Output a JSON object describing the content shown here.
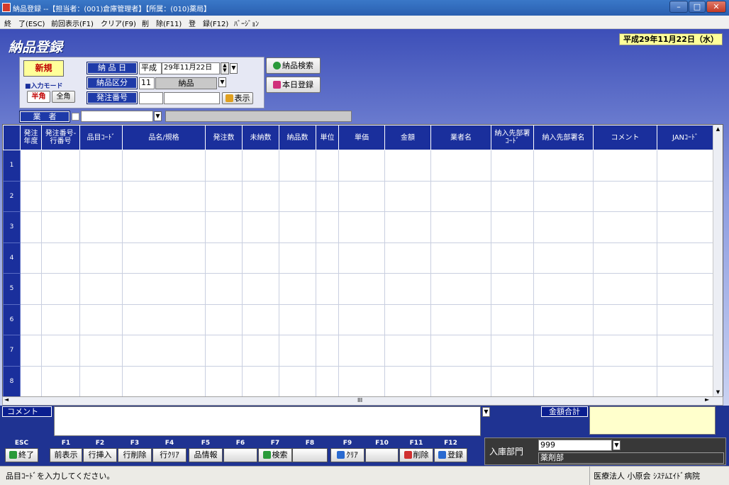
{
  "window": {
    "title": "納品登録 --【担当者：(001)倉庫管理者】【所属：(010)薬局】"
  },
  "menu": [
    "終　了(ESC)",
    "前回表示(F1)",
    "クリア(F9)",
    "削　除(F11)",
    "登　録(F12)",
    "ﾊﾞｰｼﾞｮﾝ"
  ],
  "page": {
    "title": "納品登録",
    "date": "平成29年11月22日（水）"
  },
  "form": {
    "mode_label": "新規",
    "input_mode_label": "■入力モード",
    "hankaku": "半角",
    "zenkaku": "全角",
    "delivery_date_label": "納 品 日",
    "era": "平成",
    "delivery_date": "29年11月22日",
    "delivery_type_label": "納品区分",
    "delivery_type_code": "11",
    "delivery_type_name": "納品",
    "order_no_label": "発注番号",
    "order_no": "",
    "order_no2": "",
    "show_button": "表示",
    "search_button": "納品検索",
    "today_button": "本日登録",
    "vendor_label": "業　者",
    "vendor_value": "",
    "vendor_name": ""
  },
  "grid": {
    "headers": [
      "発注\n年度",
      "発注番号-\n行番号",
      "品目ｺｰﾄﾞ",
      "品名/規格",
      "発注数",
      "未納数",
      "納品数",
      "単位",
      "単価",
      "金額",
      "業者名",
      "納入先部署\nｺｰﾄﾞ",
      "納入先部署名",
      "コメント",
      "JANｺｰﾄﾞ"
    ],
    "rows": [
      "1",
      "2",
      "3",
      "4",
      "5",
      "6",
      "7",
      "8"
    ],
    "hscroll_mark": "III"
  },
  "bottom": {
    "comment_label": "コメント",
    "comment": "",
    "sum_label": "金額合計",
    "sum": "",
    "fkeys": [
      {
        "key": "ESC",
        "label": "終了"
      },
      {
        "key": "F1",
        "label": "前表示"
      },
      {
        "key": "F2",
        "label": "行挿入"
      },
      {
        "key": "F3",
        "label": "行削除"
      },
      {
        "key": "F4",
        "label": "行ｸﾘｱ"
      },
      {
        "key": "F5",
        "label": "品情報"
      },
      {
        "key": "F6",
        "label": ""
      },
      {
        "key": "F7",
        "label": "検索"
      },
      {
        "key": "F8",
        "label": ""
      },
      {
        "key": "F9",
        "label": "ｸﾘｱ"
      },
      {
        "key": "F10",
        "label": ""
      },
      {
        "key": "F11",
        "label": "削除"
      },
      {
        "key": "F12",
        "label": "登録"
      }
    ],
    "dept_label": "入庫部門",
    "dept_code": "999",
    "dept_name": "薬剤部"
  },
  "status": {
    "message": "品目ｺｰﾄﾞを入力してください。",
    "org": "医療法人 小原会 ｼｽﾃﾑｴｲﾄﾞ病院"
  },
  "colors": {
    "accent": "#1a2f9c",
    "highlight": "#ffff99"
  }
}
